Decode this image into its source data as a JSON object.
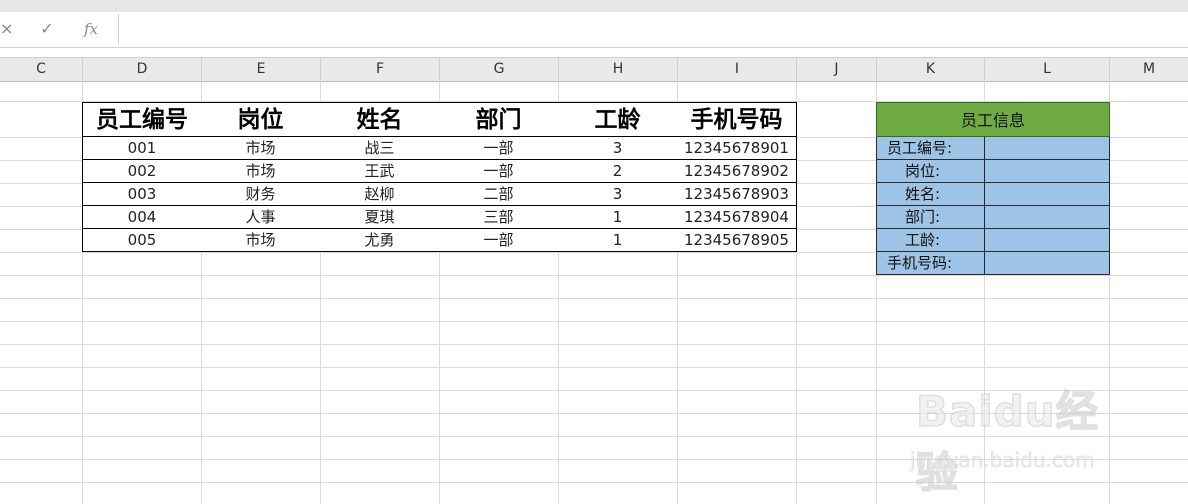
{
  "formula_bar": {
    "cancel_glyph": "×",
    "confirm_glyph": "✓",
    "fx_label": "fx",
    "content": ""
  },
  "column_headers": [
    "C",
    "D",
    "E",
    "F",
    "G",
    "H",
    "I",
    "J",
    "K",
    "L",
    "M"
  ],
  "employee_table": {
    "headers": [
      "员工编号",
      "岗位",
      "姓名",
      "部门",
      "工龄",
      "手机号码"
    ],
    "rows": [
      [
        "001",
        "市场",
        "战三",
        "一部",
        "3",
        "12345678901"
      ],
      [
        "002",
        "市场",
        "王武",
        "一部",
        "2",
        "12345678902"
      ],
      [
        "003",
        "财务",
        "赵柳",
        "二部",
        "3",
        "12345678903"
      ],
      [
        "004",
        "人事",
        "夏琪",
        "三部",
        "1",
        "12345678904"
      ],
      [
        "005",
        "市场",
        "尤勇",
        "一部",
        "1",
        "12345678905"
      ]
    ]
  },
  "info_panel": {
    "title": "员工信息",
    "labels": [
      "员工编号:",
      "岗位:",
      "姓名:",
      "部门:",
      "工龄:",
      "手机号码:"
    ]
  },
  "colors": {
    "info_title_bg": "#6fab43",
    "info_field_bg": "#9dc3e6",
    "header_bg": "#e9e9e9",
    "grid_line": "#dadada"
  },
  "watermark": {
    "brand": "Baidu经验",
    "url": "jingyan.baidu.com"
  }
}
